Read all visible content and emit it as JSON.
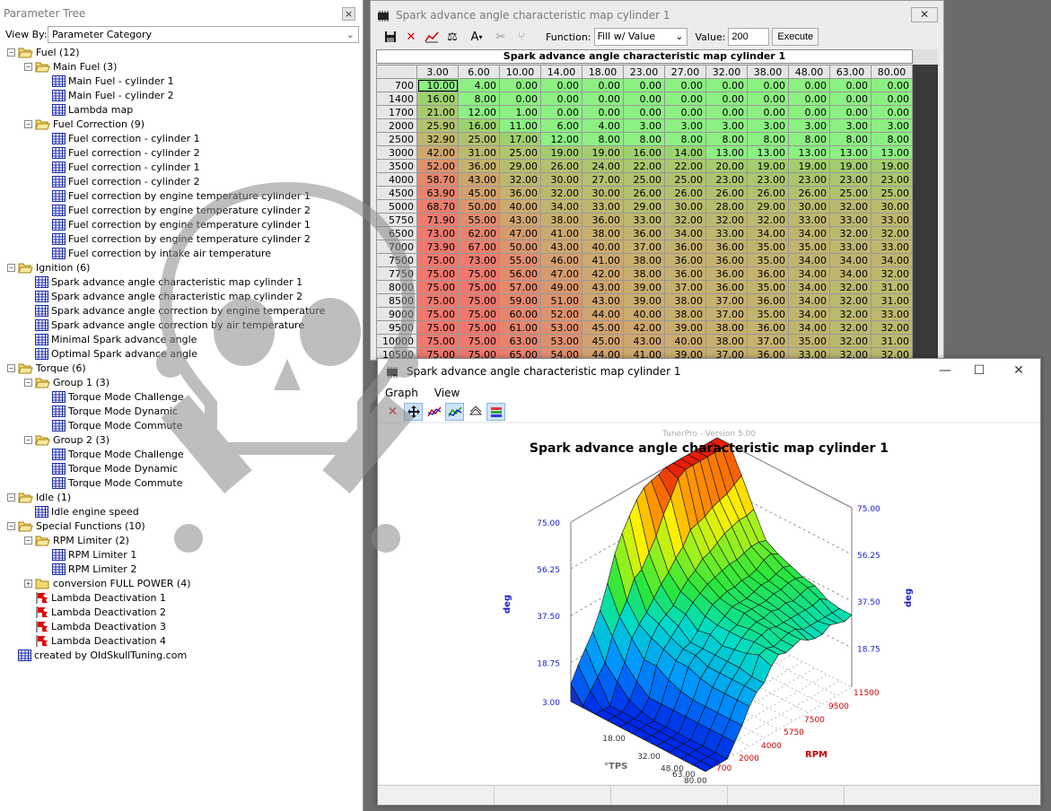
{
  "left_panel": {
    "title": "Parameter Tree",
    "close": "×",
    "view_by_label": "View By:",
    "view_by_value": "Parameter Category"
  },
  "tree": [
    {
      "label": "Fuel (12)",
      "type": "folder",
      "level": 0,
      "box": "−"
    },
    {
      "label": "Main Fuel (3)",
      "type": "folder",
      "level": 1,
      "box": "−"
    },
    {
      "label": "Main Fuel - cylinder 1",
      "type": "table",
      "level": 2
    },
    {
      "label": "Main Fuel - cylinder 2",
      "type": "table",
      "level": 2
    },
    {
      "label": "Lambda map",
      "type": "table",
      "level": 2
    },
    {
      "label": "Fuel Correction (9)",
      "type": "folder",
      "level": 1,
      "box": "−"
    },
    {
      "label": "Fuel correction - cylinder 1",
      "type": "table",
      "level": 2
    },
    {
      "label": "Fuel correction - cylinder 2",
      "type": "table",
      "level": 2
    },
    {
      "label": "Fuel correction - cylinder 1",
      "type": "table",
      "level": 2
    },
    {
      "label": "Fuel correction - cylinder 2",
      "type": "table",
      "level": 2
    },
    {
      "label": "Fuel correction by engine temperature cylinder 1",
      "type": "table",
      "level": 2
    },
    {
      "label": "Fuel correction by engine temperature cylinder 2",
      "type": "table",
      "level": 2
    },
    {
      "label": "Fuel correction by engine temperature cylinder 1",
      "type": "table",
      "level": 2
    },
    {
      "label": "Fuel correction by engine temperature cylinder 2",
      "type": "table",
      "level": 2
    },
    {
      "label": "Fuel correction by intake air temperature",
      "type": "table",
      "level": 2
    },
    {
      "label": "Ignition (6)",
      "type": "folder",
      "level": 0,
      "box": "−"
    },
    {
      "label": "Spark advance angle characteristic map cylinder 1",
      "type": "table",
      "level": 1
    },
    {
      "label": "Spark advance angle characteristic map cylinder 2",
      "type": "table",
      "level": 1
    },
    {
      "label": "Spark advance angle correction by engine temperature",
      "type": "table",
      "level": 1
    },
    {
      "label": "Spark advance angle correction by air temperature",
      "type": "table",
      "level": 1
    },
    {
      "label": "Minimal Spark advance angle",
      "type": "table",
      "level": 1
    },
    {
      "label": "Optimal Spark advance angle",
      "type": "table",
      "level": 1
    },
    {
      "label": "Torque (6)",
      "type": "folder",
      "level": 0,
      "box": "−"
    },
    {
      "label": "Group 1 (3)",
      "type": "folder",
      "level": 1,
      "box": "−"
    },
    {
      "label": "Torque Mode Challenge",
      "type": "table",
      "level": 2
    },
    {
      "label": "Torque Mode Dynamic",
      "type": "table",
      "level": 2
    },
    {
      "label": "Torque Mode Commute",
      "type": "table",
      "level": 2
    },
    {
      "label": "Group 2 (3)",
      "type": "folder",
      "level": 1,
      "box": "−"
    },
    {
      "label": "Torque Mode Challenge",
      "type": "table",
      "level": 2
    },
    {
      "label": "Torque Mode Dynamic",
      "type": "table",
      "level": 2
    },
    {
      "label": "Torque Mode Commute",
      "type": "table",
      "level": 2
    },
    {
      "label": "Idle (1)",
      "type": "folder",
      "level": 0,
      "box": "−"
    },
    {
      "label": "Idle engine speed",
      "type": "table",
      "level": 1
    },
    {
      "label": "Special Functions (10)",
      "type": "folder",
      "level": 0,
      "box": "−"
    },
    {
      "label": "RPM Limiter (2)",
      "type": "folder",
      "level": 1,
      "box": "−"
    },
    {
      "label": "RPM Limiter 1",
      "type": "table",
      "level": 2
    },
    {
      "label": "RPM Limiter 2",
      "type": "table",
      "level": 2
    },
    {
      "label": "conversion FULL POWER (4)",
      "type": "folder-closed",
      "level": 1,
      "box": "+"
    },
    {
      "label": "Lambda Deactivation 1",
      "type": "flag",
      "level": 1
    },
    {
      "label": "Lambda Deactivation 2",
      "type": "flag",
      "level": 1
    },
    {
      "label": "Lambda Deactivation 3",
      "type": "flag",
      "level": 1
    },
    {
      "label": "Lambda Deactivation 4",
      "type": "flag",
      "level": 1
    },
    {
      "label": "created by OldSkullTuning.com",
      "type": "table",
      "level": 0
    }
  ],
  "map_window": {
    "title": "Spark advance angle characteristic map cylinder 1",
    "close": "✕",
    "function_label": "Function:",
    "function_value": "Fill w/ Value",
    "value_label": "Value:",
    "value": "200",
    "execute": "Execute",
    "grid_title": "Spark advance angle characteristic map cylinder 1",
    "col_headers": [
      "3.00",
      "6.00",
      "10.00",
      "14.00",
      "18.00",
      "23.00",
      "27.00",
      "32.00",
      "38.00",
      "48.00",
      "63.00",
      "80.00"
    ],
    "rows": [
      {
        "rpm": "700",
        "v": [
          "10.00",
          "4.00",
          "0.00",
          "0.00",
          "0.00",
          "0.00",
          "0.00",
          "0.00",
          "0.00",
          "0.00",
          "0.00",
          "0.00"
        ]
      },
      {
        "rpm": "1400",
        "v": [
          "16.00",
          "8.00",
          "0.00",
          "0.00",
          "0.00",
          "0.00",
          "0.00",
          "0.00",
          "0.00",
          "0.00",
          "0.00",
          "0.00"
        ]
      },
      {
        "rpm": "1700",
        "v": [
          "21.00",
          "12.00",
          "1.00",
          "0.00",
          "0.00",
          "0.00",
          "0.00",
          "0.00",
          "0.00",
          "0.00",
          "0.00",
          "0.00"
        ]
      },
      {
        "rpm": "2000",
        "v": [
          "25.90",
          "16.00",
          "11.00",
          "6.00",
          "4.00",
          "3.00",
          "3.00",
          "3.00",
          "3.00",
          "3.00",
          "3.00",
          "3.00"
        ]
      },
      {
        "rpm": "2500",
        "v": [
          "32.90",
          "25.00",
          "17.00",
          "12.00",
          "8.00",
          "8.00",
          "8.00",
          "8.00",
          "8.00",
          "8.00",
          "8.00",
          "8.00"
        ]
      },
      {
        "rpm": "3000",
        "v": [
          "42.00",
          "31.00",
          "25.00",
          "19.00",
          "19.00",
          "16.00",
          "14.00",
          "13.00",
          "13.00",
          "13.00",
          "13.00",
          "13.00"
        ]
      },
      {
        "rpm": "3500",
        "v": [
          "52.00",
          "36.00",
          "29.00",
          "26.00",
          "24.00",
          "22.00",
          "22.00",
          "20.00",
          "19.00",
          "19.00",
          "19.00",
          "19.00"
        ]
      },
      {
        "rpm": "4000",
        "v": [
          "58.70",
          "43.00",
          "32.00",
          "30.00",
          "27.00",
          "25.00",
          "25.00",
          "23.00",
          "23.00",
          "23.00",
          "23.00",
          "23.00"
        ]
      },
      {
        "rpm": "4500",
        "v": [
          "63.90",
          "45.00",
          "36.00",
          "32.00",
          "30.00",
          "26.00",
          "26.00",
          "26.00",
          "26.00",
          "26.00",
          "25.00",
          "25.00"
        ]
      },
      {
        "rpm": "5000",
        "v": [
          "68.70",
          "50.00",
          "40.00",
          "34.00",
          "33.00",
          "29.00",
          "30.00",
          "28.00",
          "29.00",
          "30.00",
          "32.00",
          "30.00"
        ]
      },
      {
        "rpm": "5750",
        "v": [
          "71.90",
          "55.00",
          "43.00",
          "38.00",
          "36.00",
          "33.00",
          "32.00",
          "32.00",
          "32.00",
          "33.00",
          "33.00",
          "33.00"
        ]
      },
      {
        "rpm": "6500",
        "v": [
          "73.00",
          "62.00",
          "47.00",
          "41.00",
          "38.00",
          "36.00",
          "34.00",
          "33.00",
          "34.00",
          "34.00",
          "32.00",
          "32.00"
        ]
      },
      {
        "rpm": "7000",
        "v": [
          "73.90",
          "67.00",
          "50.00",
          "43.00",
          "40.00",
          "37.00",
          "36.00",
          "36.00",
          "35.00",
          "35.00",
          "33.00",
          "33.00"
        ]
      },
      {
        "rpm": "7500",
        "v": [
          "75.00",
          "73.00",
          "55.00",
          "46.00",
          "41.00",
          "38.00",
          "36.00",
          "36.00",
          "35.00",
          "34.00",
          "34.00",
          "34.00"
        ]
      },
      {
        "rpm": "7750",
        "v": [
          "75.00",
          "75.00",
          "56.00",
          "47.00",
          "42.00",
          "38.00",
          "36.00",
          "36.00",
          "36.00",
          "34.00",
          "34.00",
          "32.00"
        ]
      },
      {
        "rpm": "8000",
        "v": [
          "75.00",
          "75.00",
          "57.00",
          "49.00",
          "43.00",
          "39.00",
          "37.00",
          "36.00",
          "35.00",
          "34.00",
          "32.00",
          "31.00"
        ]
      },
      {
        "rpm": "8500",
        "v": [
          "75.00",
          "75.00",
          "59.00",
          "51.00",
          "43.00",
          "39.00",
          "38.00",
          "37.00",
          "36.00",
          "34.00",
          "32.00",
          "31.00"
        ]
      },
      {
        "rpm": "9000",
        "v": [
          "75.00",
          "75.00",
          "60.00",
          "52.00",
          "44.00",
          "40.00",
          "38.00",
          "37.00",
          "35.00",
          "34.00",
          "32.00",
          "33.00"
        ]
      },
      {
        "rpm": "9500",
        "v": [
          "75.00",
          "75.00",
          "61.00",
          "53.00",
          "45.00",
          "42.00",
          "39.00",
          "38.00",
          "36.00",
          "34.00",
          "32.00",
          "32.00"
        ]
      },
      {
        "rpm": "10000",
        "v": [
          "75.00",
          "75.00",
          "63.00",
          "53.00",
          "45.00",
          "43.00",
          "40.00",
          "38.00",
          "37.00",
          "35.00",
          "32.00",
          "31.00"
        ]
      },
      {
        "rpm": "10500",
        "v": [
          "75.00",
          "75.00",
          "65.00",
          "54.00",
          "44.00",
          "41.00",
          "39.00",
          "37.00",
          "36.00",
          "33.00",
          "32.00",
          "32.00"
        ]
      }
    ]
  },
  "graph_window": {
    "title": "Spark advance angle characteristic map cylinder 1",
    "menu": [
      "Graph",
      "View"
    ],
    "minimize": "—",
    "maximize": "☐",
    "close": "✕",
    "version": "TunerPro - Version 5.00",
    "chart_title": "Spark advance angle characteristic map cylinder 1",
    "left_ticks": [
      "75.00",
      "56.25",
      "37.50",
      "18.75",
      "3.00"
    ],
    "right_ticks": [
      "75.00",
      "56.25",
      "37.50",
      "18.75"
    ],
    "z_label": "deg",
    "tps_ticks": [
      "18.00",
      "32.00",
      "48.00",
      "63.00",
      "80.00"
    ],
    "tps_label": "°TPS",
    "rpm_ticks": [
      "700",
      "2000",
      "4000",
      "5750",
      "7500",
      "9500",
      "11500"
    ],
    "rpm_label": "RPM"
  },
  "colors": {
    "accent": "#0000cc",
    "rpm": "#cc0000"
  }
}
